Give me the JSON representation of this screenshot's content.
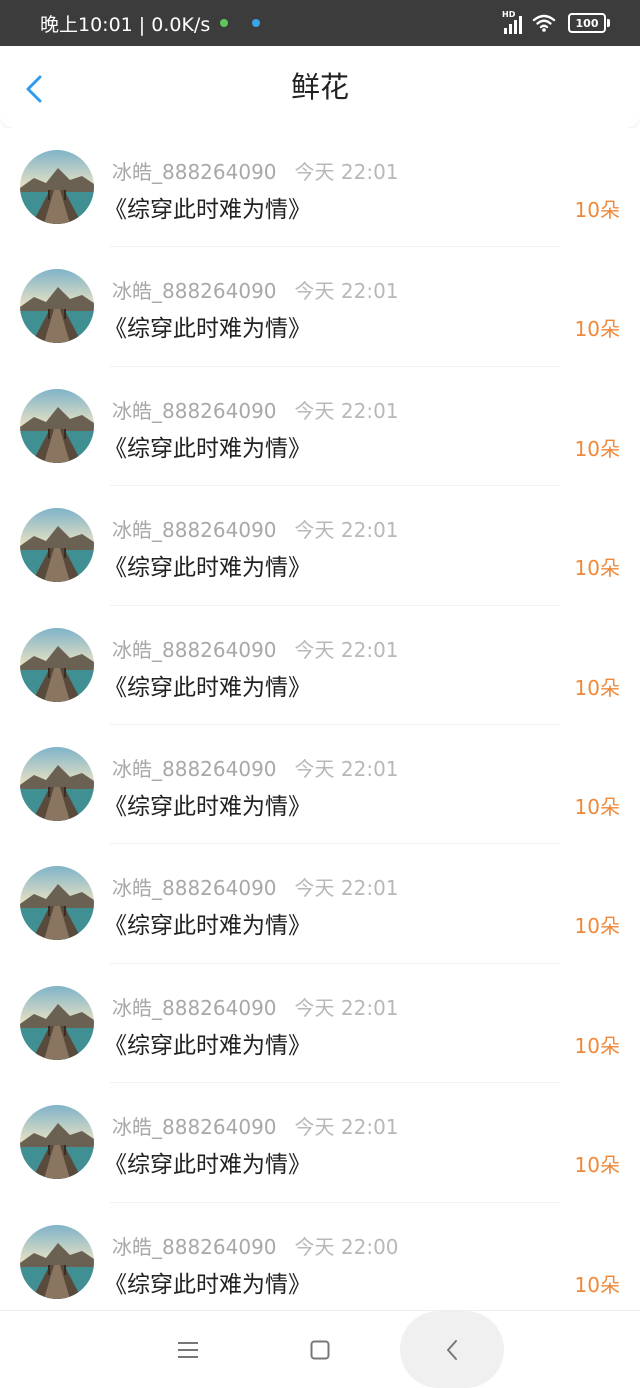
{
  "status_bar": {
    "time_speed": "晚上10:01 | 0.0K/s",
    "hd_label": "HD",
    "battery": "100",
    "dot_colors": [
      "#5cc85c",
      "#3aa4e8"
    ]
  },
  "header": {
    "title": "鲜花",
    "accent_color": "#2f9cf0"
  },
  "items": [
    {
      "user": "冰皓_888264090",
      "time": "今天 22:01",
      "book": "《综穿此时难为情》",
      "amount": "10朵"
    },
    {
      "user": "冰皓_888264090",
      "time": "今天 22:01",
      "book": "《综穿此时难为情》",
      "amount": "10朵"
    },
    {
      "user": "冰皓_888264090",
      "time": "今天 22:01",
      "book": "《综穿此时难为情》",
      "amount": "10朵"
    },
    {
      "user": "冰皓_888264090",
      "time": "今天 22:01",
      "book": "《综穿此时难为情》",
      "amount": "10朵"
    },
    {
      "user": "冰皓_888264090",
      "time": "今天 22:01",
      "book": "《综穿此时难为情》",
      "amount": "10朵"
    },
    {
      "user": "冰皓_888264090",
      "time": "今天 22:01",
      "book": "《综穿此时难为情》",
      "amount": "10朵"
    },
    {
      "user": "冰皓_888264090",
      "time": "今天 22:01",
      "book": "《综穿此时难为情》",
      "amount": "10朵"
    },
    {
      "user": "冰皓_888264090",
      "time": "今天 22:01",
      "book": "《综穿此时难为情》",
      "amount": "10朵"
    },
    {
      "user": "冰皓_888264090",
      "time": "今天 22:01",
      "book": "《综穿此时难为情》",
      "amount": "10朵"
    },
    {
      "user": "冰皓_888264090",
      "time": "今天 22:00",
      "book": "《综穿此时难为情》",
      "amount": "10朵"
    }
  ],
  "nav_bar": {
    "icons": [
      "menu-icon",
      "home-square-icon",
      "back-chevron-icon"
    ]
  }
}
